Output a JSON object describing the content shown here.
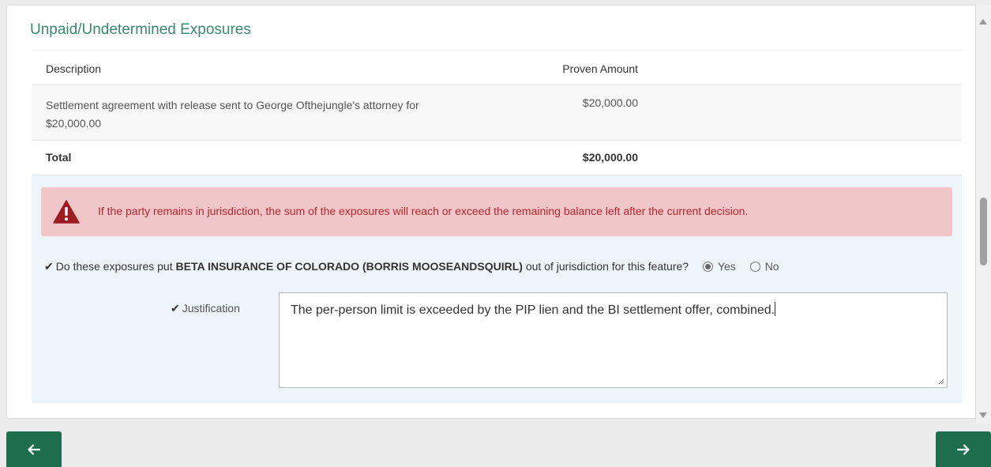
{
  "section": {
    "title": "Unpaid/Undetermined Exposures"
  },
  "table": {
    "headers": {
      "description": "Description",
      "amount": "Proven Amount"
    },
    "rows": [
      {
        "description": "Settlement agreement with release sent to George Ofthejungle's attorney for $20,000.00",
        "amount": "$20,000.00"
      }
    ],
    "total": {
      "label": "Total",
      "amount": "$20,000.00"
    }
  },
  "alert": {
    "icon": "warning-triangle-icon",
    "text": "If the party remains in jurisdiction, the sum of the exposures will reach or exceed the remaining balance left after the current decision."
  },
  "question": {
    "prefix": "Do these exposures put ",
    "entity": "BETA INSURANCE OF COLORADO (BORRIS MOOSEANDSQUIRL)",
    "suffix": " out of jurisdiction for this feature?",
    "options": [
      "Yes",
      "No"
    ],
    "selected": "Yes"
  },
  "justification": {
    "label": "Justification",
    "value": "The per-person limit is exceeded by the PIP lien and the BI settlement offer, combined."
  },
  "colors": {
    "accent": "#1c6e4d",
    "title": "#3b8a6e",
    "alert_bg": "#f1c6c8",
    "alert_text": "#b3262e"
  },
  "nav": {
    "prev_icon": "arrow-left-icon",
    "next_icon": "arrow-right-icon"
  }
}
